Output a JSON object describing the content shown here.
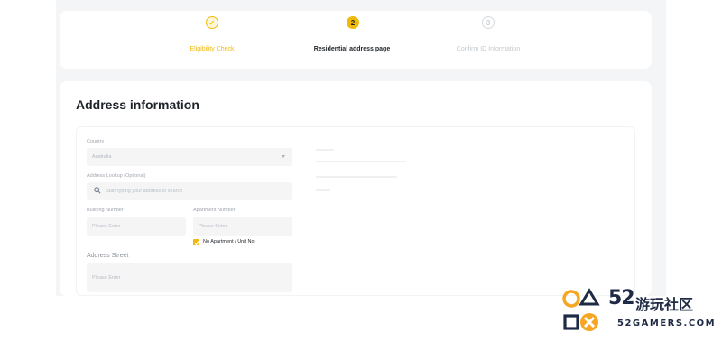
{
  "stepper": {
    "steps": [
      {
        "label": "Eligibility Check",
        "marker": "✓"
      },
      {
        "label": "Residential address page",
        "marker": "2"
      },
      {
        "label": "Confirm ID Information",
        "marker": "3"
      }
    ]
  },
  "form": {
    "title": "Address information",
    "country": {
      "label": "Country",
      "value": "Australia"
    },
    "lookup": {
      "label": "Address Lookup (Optional)",
      "placeholder": "Start typing your address to search"
    },
    "building": {
      "label": "Building Number",
      "placeholder": "Please Enter"
    },
    "apartment": {
      "label": "Apartment Number",
      "placeholder": "Please Enter"
    },
    "no_apartment": {
      "label": "No Apartment / Unit No.",
      "checked": true
    },
    "street": {
      "label": "Address Street",
      "placeholder": "Please Enter"
    }
  },
  "watermark": {
    "number": "52",
    "cn": "游玩社区",
    "site": "52GAMERS.COM"
  },
  "colors": {
    "accent": "#f0b90b",
    "watermark": "#1f2a44",
    "watermark_shapes": "#f5a623"
  }
}
